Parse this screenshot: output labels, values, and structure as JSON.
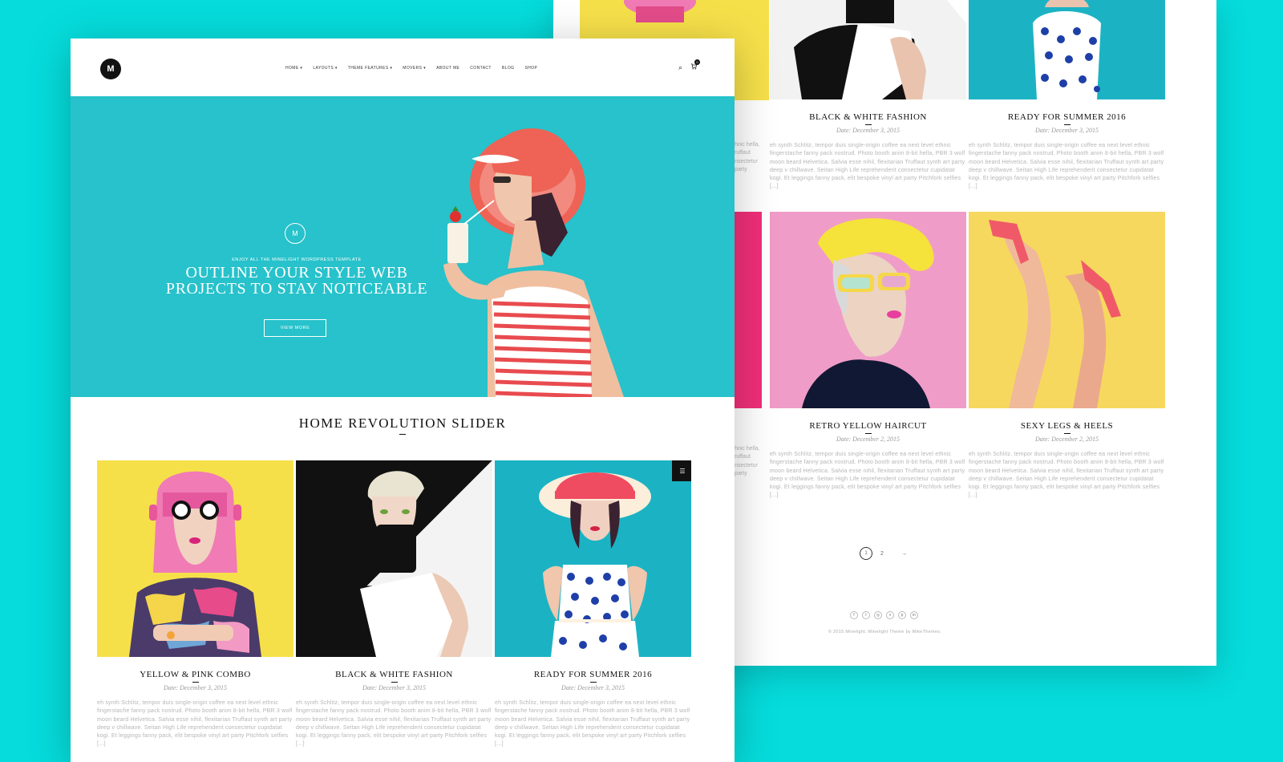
{
  "colors": {
    "background": "#06dcdc",
    "hero": "#27c2cb",
    "yellow": "#f6e04a",
    "pink": "#f07bb5",
    "teal": "#1bb3c4"
  },
  "back_page": {
    "cards": [
      {
        "title": "BLACK & WHITE FASHION",
        "date": "Date: December 3, 2015",
        "excerpt": "eh synth Schlitz, tempor duis single-origin coffee ea next level ethnic fingerstache fanny pack nostrud. Photo booth anim 8-bit hella, PBR 3 wolf moon beard Helvetica. Salvia esse nihil, flexitarian Truffaut synth art party deep v chillwave. Seitan High Life reprehenderit consectetur cupidatat kogi. Et leggings fanny pack, elit bespoke vinyl art party Pitchfork selfies [...]"
      },
      {
        "title": "READY FOR SUMMER 2016",
        "date": "Date: December 3, 2015",
        "excerpt": "eh synth Schlitz, tempor duis single-origin coffee ea next level ethnic fingerstache fanny pack nostrud. Photo booth anim 8-bit hella, PBR 3 wolf moon beard Helvetica. Salvia esse nihil, flexitarian Truffaut synth art party deep v chillwave. Seitan High Life reprehenderit consectetur cupidatat kogi. Et leggings fanny pack, elit bespoke vinyl art party Pitchfork selfies [...]"
      },
      {
        "title": "RETRO YELLOW HAIRCUT",
        "date": "Date: December 2, 2015",
        "excerpt": "eh synth Schlitz, tempor duis single-origin coffee ea next level ethnic fingerstache fanny pack nostrud. Photo booth anim 8-bit hella, PBR 3 wolf moon beard Helvetica. Salvia esse nihil, flexitarian Truffaut synth art party deep v chillwave. Seitan High Life reprehenderit consectetur cupidatat kogi. Et leggings fanny pack, elit bespoke vinyl art party Pitchfork selfies [...]"
      },
      {
        "title": "SEXY LEGS & HEELS",
        "date": "Date: December 2, 2015",
        "excerpt": "eh synth Schlitz, tempor duis single-origin coffee ea next level ethnic fingerstache fanny pack nostrud. Photo booth anim 8-bit hella, PBR 3 wolf moon beard Helvetica. Salvia esse nihil, flexitarian Truffaut synth art party deep v chillwave. Seitan High Life reprehenderit consectetur cupidatat kogi. Et leggings fanny pack, elit bespoke vinyl art party Pitchfork selfies [...]"
      }
    ],
    "partial_excerpt": "t level ethnic hella, PBR 3 Truffaut synth consectetur vinyl art party",
    "pagination": {
      "page1": "1",
      "page2": "2",
      "next": "→"
    },
    "socials": [
      "f",
      "t",
      "◎",
      "v",
      "p",
      "in"
    ],
    "copyright": "© 2015 Minelight. Minelight Theme by MikeThemes."
  },
  "front_page": {
    "logo": "M",
    "nav": [
      "HOME ▾",
      "LAYOUTS ▾",
      "THEME FEATURES ▾",
      "MOVERS ▾",
      "ABOUT ME",
      "CONTACT",
      "BLOG",
      "SHOP"
    ],
    "search_icon": "⌕",
    "cart_icon": "🛒",
    "cart_count": "0",
    "hero": {
      "emblem": "M",
      "kicker": "ENJOY ALL THE MINELIGHT WORDPRESS TEMPLATE",
      "title_line1": "OUTLINE YOUR STYLE WEB",
      "title_line2": "PROJECTS TO STAY NOTICEABLE",
      "button": "VIEW MORE"
    },
    "section_title": "HOME REVOLUTION SLIDER",
    "grid_toggle": "☰",
    "cards": [
      {
        "title": "YELLOW & PINK COMBO",
        "date": "Date: December 3, 2015",
        "excerpt": "eh synth Schlitz, tempor duis single-origin coffee ea next level ethnic fingerstache fanny pack nostrud. Photo booth anim 8-bit hella, PBR 3 wolf moon beard Helvetica. Salvia esse nihil, flexitarian Truffaut synth art party deep v chillwave. Seitan High Life reprehenderit consectetur cupidatat kogi. Et leggings fanny pack, elit bespoke vinyl art party Pitchfork selfies [...]"
      },
      {
        "title": "BLACK & WHITE FASHION",
        "date": "Date: December 3, 2015",
        "excerpt": "eh synth Schlitz, tempor duis single-origin coffee ea next level ethnic fingerstache fanny pack nostrud. Photo booth anim 8-bit hella, PBR 3 wolf moon beard Helvetica. Salvia esse nihil, flexitarian Truffaut synth art party deep v chillwave. Seitan High Life reprehenderit consectetur cupidatat kogi. Et leggings fanny pack, elit bespoke vinyl art party Pitchfork selfies [...]"
      },
      {
        "title": "READY FOR SUMMER 2016",
        "date": "Date: December 3, 2015",
        "excerpt": "eh synth Schlitz, tempor duis single-origin coffee ea next level ethnic fingerstache fanny pack nostrud. Photo booth anim 8-bit hella, PBR 3 wolf moon beard Helvetica. Salvia esse nihil, flexitarian Truffaut synth art party deep v chillwave. Seitan High Life reprehenderit consectetur cupidatat kogi. Et leggings fanny pack, elit bespoke vinyl art party Pitchfork selfies [...]"
      }
    ]
  }
}
